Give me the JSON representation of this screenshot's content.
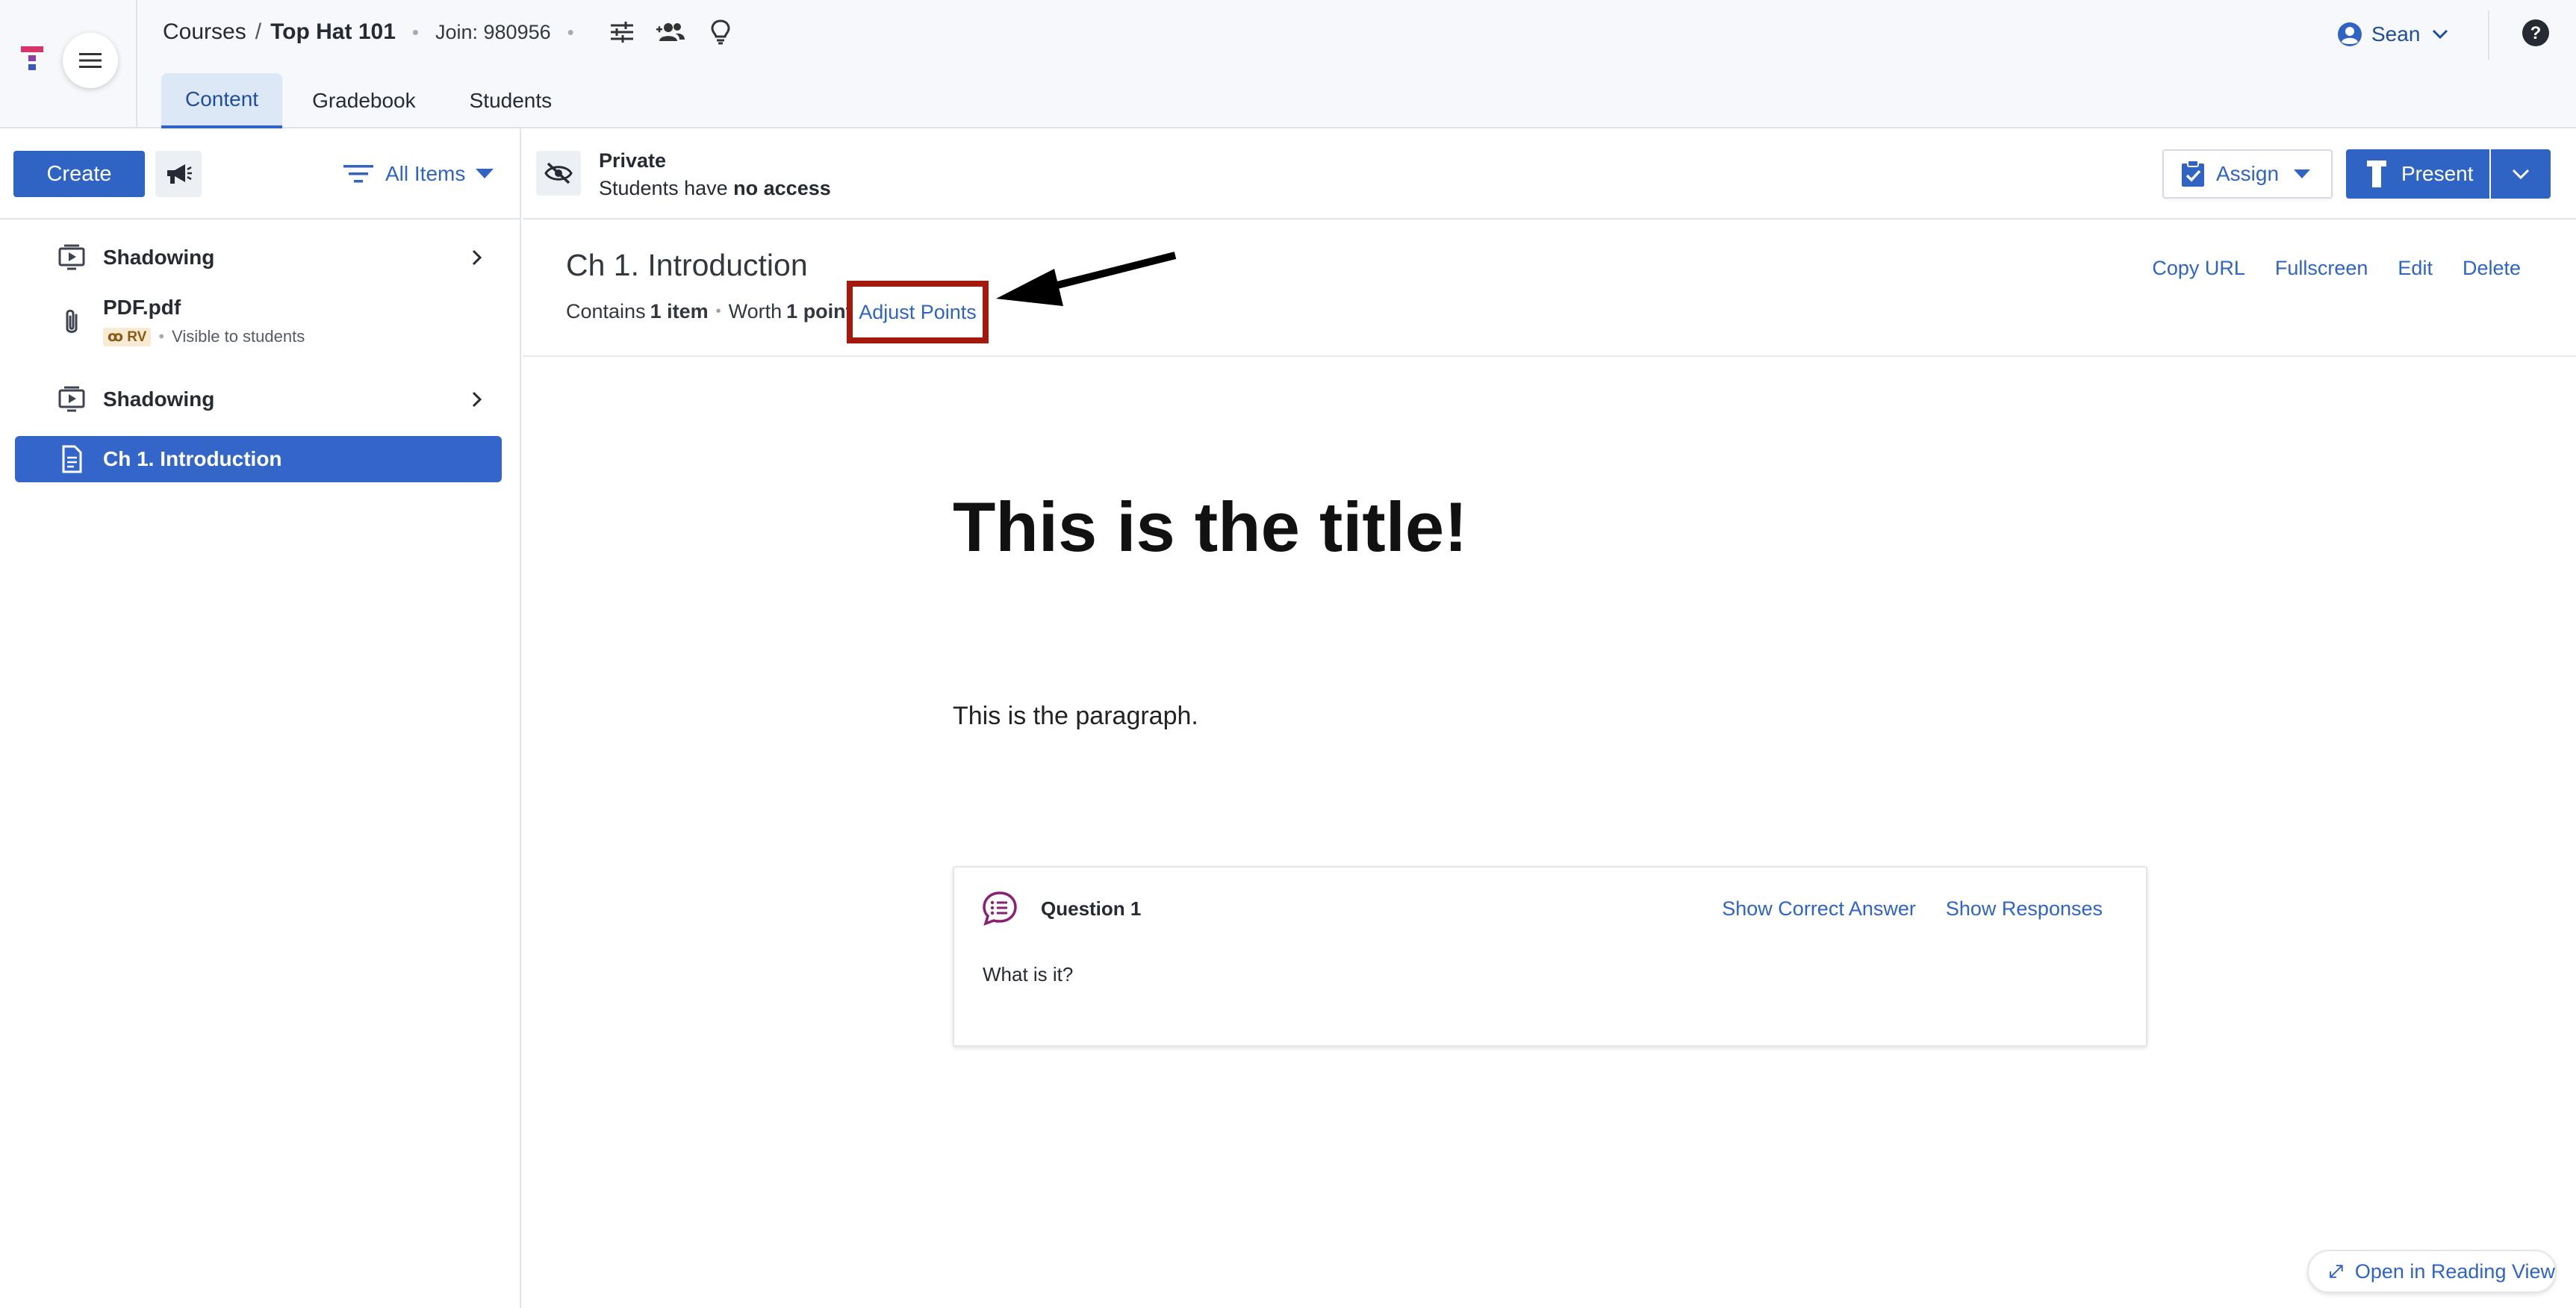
{
  "colors": {
    "accent": "#2f64c5",
    "header_bg": "#f6f8fc",
    "active_item_bg": "#3466c9",
    "highlight_box": "#a3190d"
  },
  "header": {
    "breadcrumb": {
      "root": "Courses",
      "separator": "/",
      "current": "Top Hat 101"
    },
    "join_text": "Join: 980956",
    "tabs": [
      {
        "label": "Content",
        "active": true
      },
      {
        "label": "Gradebook",
        "active": false
      },
      {
        "label": "Students",
        "active": false
      }
    ],
    "user_name": "Sean",
    "icons": [
      "tophat-logo-icon",
      "hamburger-menu-icon",
      "sliders-icon",
      "people-icon",
      "lightbulb-icon",
      "user-circle-icon",
      "chevron-down-icon",
      "help-icon"
    ]
  },
  "sidebar": {
    "create_label": "Create",
    "filter_label": "All Items",
    "items": [
      {
        "title": "Shadowing",
        "icon": "presentation-icon",
        "has_chevron": true,
        "active": false
      },
      {
        "title": "PDF.pdf",
        "icon": "paperclip-icon",
        "badge": "RV",
        "meta": "Visible to students",
        "active": false
      },
      {
        "title": "Shadowing",
        "icon": "presentation-icon",
        "has_chevron": true,
        "active": false
      },
      {
        "title": "Ch 1. Introduction",
        "icon": "document-icon",
        "active": true
      }
    ]
  },
  "toolbar": {
    "visibility_status": "Private",
    "visibility_sub_prefix": "Students have",
    "visibility_sub_bold": "no access",
    "assign_label": "Assign",
    "present_label": "Present"
  },
  "page": {
    "title": "Ch 1. Introduction",
    "contains_prefix": "Contains",
    "contains_value": "1 item",
    "worth_prefix": "Worth",
    "worth_value": "1 point",
    "adjust_points_label": "Adjust Points",
    "actions": [
      "Copy URL",
      "Fullscreen",
      "Edit",
      "Delete"
    ]
  },
  "document": {
    "title": "This is the title!",
    "paragraph": "This is the paragraph."
  },
  "question": {
    "title": "Question 1",
    "show_correct_answer": "Show Correct Answer",
    "show_responses": "Show Responses",
    "text": "What is it?"
  },
  "reading_view_label": "Open in Reading View"
}
